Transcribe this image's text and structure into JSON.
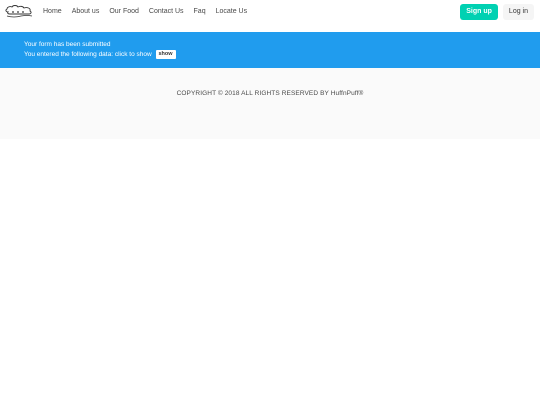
{
  "nav": {
    "logo_icon": "cloud-logo-icon",
    "links": [
      "Home",
      "About us",
      "Our Food",
      "Contact Us",
      "Faq",
      "Locate Us"
    ],
    "signup_label": "Sign up",
    "login_label": "Log in"
  },
  "notification": {
    "line1": "Your form has been submitted",
    "line2": "You entered the following data: click to show",
    "show_label": "show"
  },
  "footer": {
    "copyright": "COPYRIGHT © 2018 ALL RIGHTS RESERVED BY ",
    "brand": "HuffnPuff®"
  },
  "colors": {
    "notification_bg": "#209cee",
    "signup_bg": "#00d1b2",
    "footer_bg": "#fafafa"
  }
}
